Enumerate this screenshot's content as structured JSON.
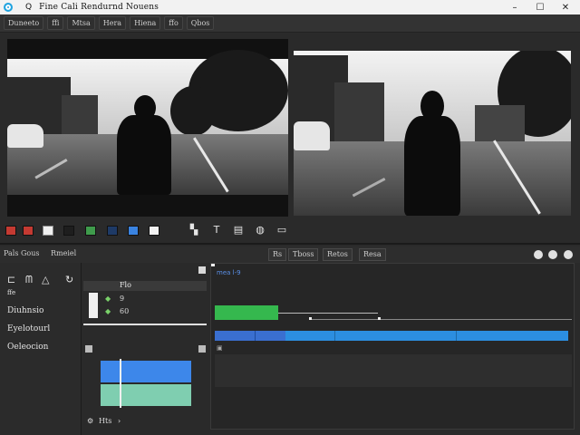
{
  "window": {
    "title": "Fine Cali Rendurnd Nouens",
    "search_glyph": "Q",
    "controls": [
      "–",
      "☐",
      "✕"
    ]
  },
  "menu": [
    "Duneeto",
    "ffi",
    "Mtsa",
    "Hera",
    "Hiena",
    "ffo",
    "Qbos"
  ],
  "swatches": [
    "#c43a32",
    "#c43a32",
    "#f0f0f0",
    "#1e1e1e",
    "#3f9b4c",
    "#1e3a66",
    "#3a83e0",
    "#f2f2f2"
  ],
  "panel_tabs": {
    "left": "Pals Gous",
    "right": "Rmeiel",
    "buttons": [
      "Rs",
      "Tboss",
      "Retos",
      "Resa"
    ]
  },
  "left_panel": {
    "icon_label": "ffe",
    "items": [
      "Diuhnsio",
      "Eyelotourl",
      "Oeleocion"
    ]
  },
  "mid_panel": {
    "header": "Flo",
    "rows": [
      "9",
      "60"
    ],
    "footer": "Hts"
  },
  "timeline": {
    "label": "mea l-9"
  }
}
